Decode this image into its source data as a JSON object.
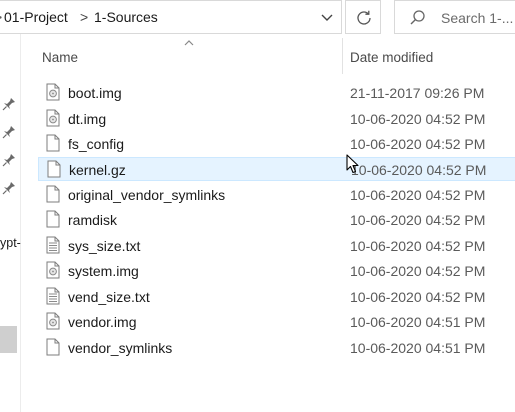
{
  "address_bar": {
    "breadcrumbs": [
      "01-Project",
      "1-Sources"
    ],
    "separators": [
      ">",
      ">"
    ]
  },
  "search": {
    "placeholder": "Search 1-..."
  },
  "nav_pane": {
    "partial_label": "ypt-"
  },
  "columns": {
    "name": "Name",
    "date_modified": "Date modified"
  },
  "files": [
    {
      "name": "boot.img",
      "date": "21-11-2017 09:26 PM",
      "icon": "disk-image-file-icon"
    },
    {
      "name": "dt.img",
      "date": "10-06-2020 04:52 PM",
      "icon": "disk-image-file-icon"
    },
    {
      "name": "fs_config",
      "date": "10-06-2020 04:52 PM",
      "icon": "blank-file-icon"
    },
    {
      "name": "kernel.gz",
      "date": "10-06-2020 04:52 PM",
      "icon": "blank-file-icon",
      "highlighted": true
    },
    {
      "name": "original_vendor_symlinks",
      "date": "10-06-2020 04:52 PM",
      "icon": "blank-file-icon"
    },
    {
      "name": "ramdisk",
      "date": "10-06-2020 04:52 PM",
      "icon": "blank-file-icon"
    },
    {
      "name": "sys_size.txt",
      "date": "10-06-2020 04:52 PM",
      "icon": "text-file-icon"
    },
    {
      "name": "system.img",
      "date": "10-06-2020 04:52 PM",
      "icon": "disk-image-file-icon"
    },
    {
      "name": "vend_size.txt",
      "date": "10-06-2020 04:52 PM",
      "icon": "text-file-icon"
    },
    {
      "name": "vendor.img",
      "date": "10-06-2020 04:51 PM",
      "icon": "disk-image-file-icon"
    },
    {
      "name": "vendor_symlinks",
      "date": "10-06-2020 04:51 PM",
      "icon": "blank-file-icon"
    }
  ],
  "colors": {
    "hover_bg": "#e5f3ff",
    "hover_border": "#cce8ff",
    "nav_selected": "#cfcfcf"
  }
}
